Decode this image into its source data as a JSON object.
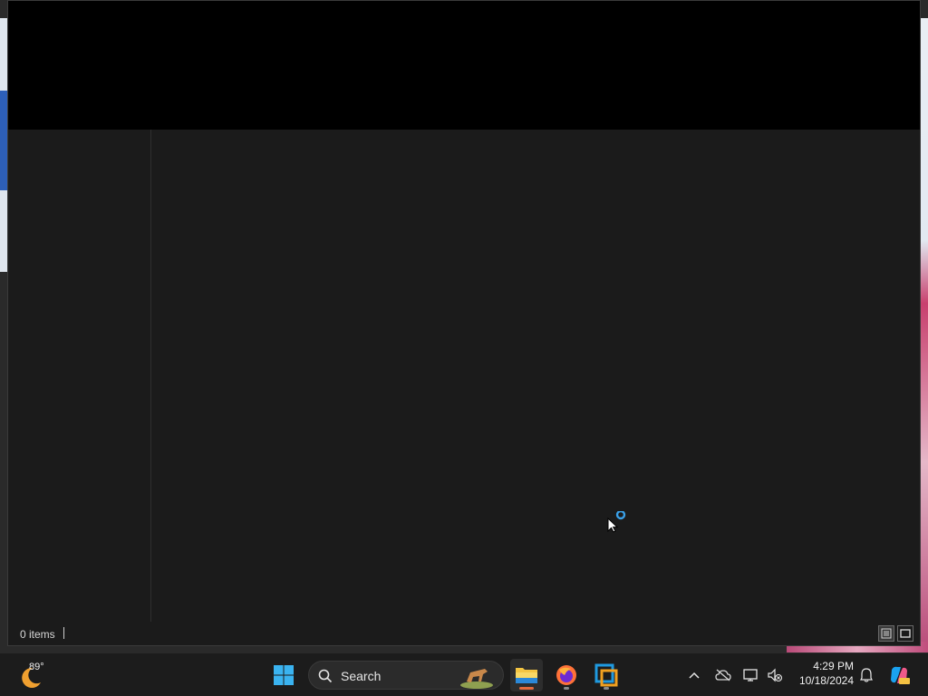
{
  "window": {
    "status": {
      "item_count": "0 items"
    },
    "view_buttons": [
      "details-view-icon",
      "tiles-view-icon"
    ]
  },
  "taskbar": {
    "weather": {
      "temp": "89°",
      "icon": "moon-weather-icon"
    },
    "search": {
      "label": "Search"
    },
    "pinned": [
      {
        "name": "start-icon"
      },
      {
        "name": "file-explorer-icon",
        "active": true
      },
      {
        "name": "firefox-icon"
      },
      {
        "name": "virtualbox-icon"
      }
    ],
    "tray": [
      "chevron-up-icon",
      "onedrive-icon",
      "network-icon",
      "volume-muted-icon",
      "notification-bell-icon",
      "copilot-icon"
    ],
    "clock": {
      "time": "4:29 PM",
      "date": "10/18/2024"
    }
  },
  "colors": {
    "accent": "#e46a3c",
    "window_bg": "#1b1b1b",
    "titlebar_bg": "#000000",
    "taskbar_bg": "#1c1c1c"
  }
}
